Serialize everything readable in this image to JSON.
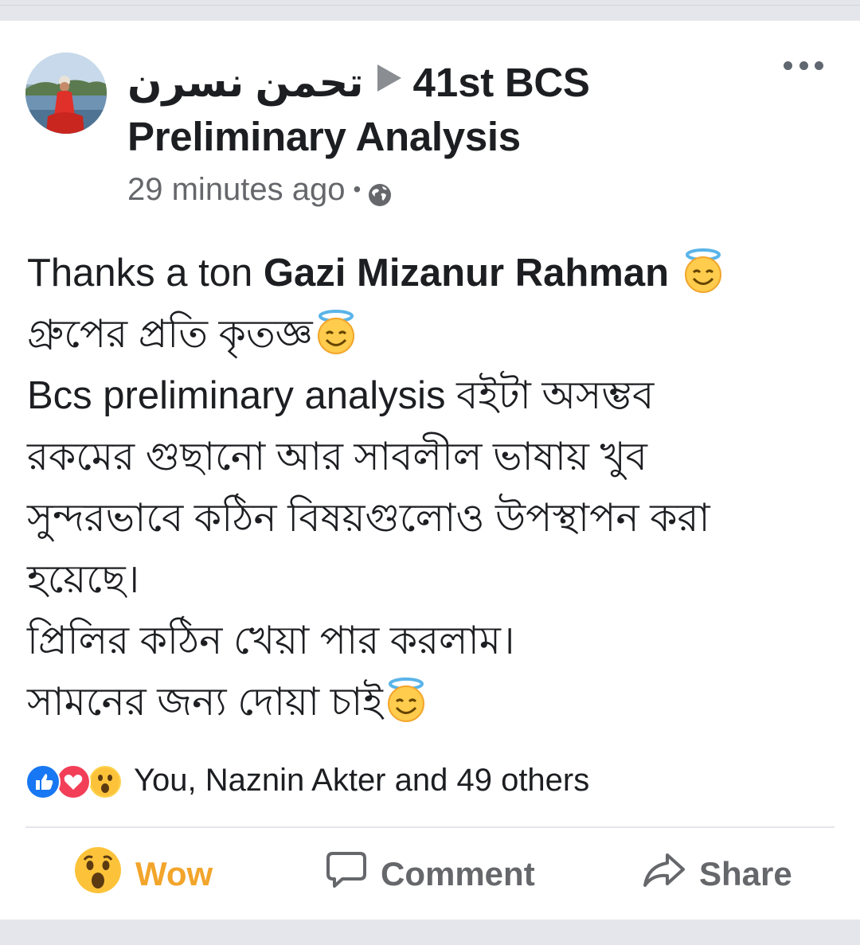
{
  "post": {
    "author_name": "تحمن نسرن",
    "group_name": "41st BCS Preliminary Analysis",
    "timestamp": "29 minutes ago",
    "separator": "•",
    "privacy_icon": "globe-icon",
    "more_icon": "more-horizontal-icon",
    "body": {
      "line1_prefix": "Thanks a ton ",
      "line1_bold": "Gazi Mizanur Rahman",
      "line2": " গ্রুপের প্রতি কৃতজ্ঞ",
      "line3": "Bcs preliminary analysis বইটা অসম্ভব",
      "line4": "রকমের গুছানো আর সাবলীল ভাষায় খুব",
      "line5": "সুন্দরভাবে কঠিন বিষয়গুলোও উপস্থাপন করা",
      "line6": "হয়েছে।",
      "line7": "প্রিলির কঠিন খেয়া পার করলাম।",
      "line8": "সামনের জন্য দোয়া চাই",
      "emoji_name": "smiling-face-with-halo-icon"
    }
  },
  "reactions": {
    "icons": [
      "like-icon",
      "love-icon",
      "wow-icon"
    ],
    "summary": "You, Naznin Akter and 49 others"
  },
  "actions": {
    "wow_label": "Wow",
    "comment_label": "Comment",
    "share_label": "Share"
  },
  "colors": {
    "text_primary": "#1c1e21",
    "text_secondary": "#65676b",
    "wow_active": "#f2a52b",
    "like_blue": "#1877f2",
    "love_red": "#f33e58",
    "separator_gray": "#e4e6eb"
  }
}
